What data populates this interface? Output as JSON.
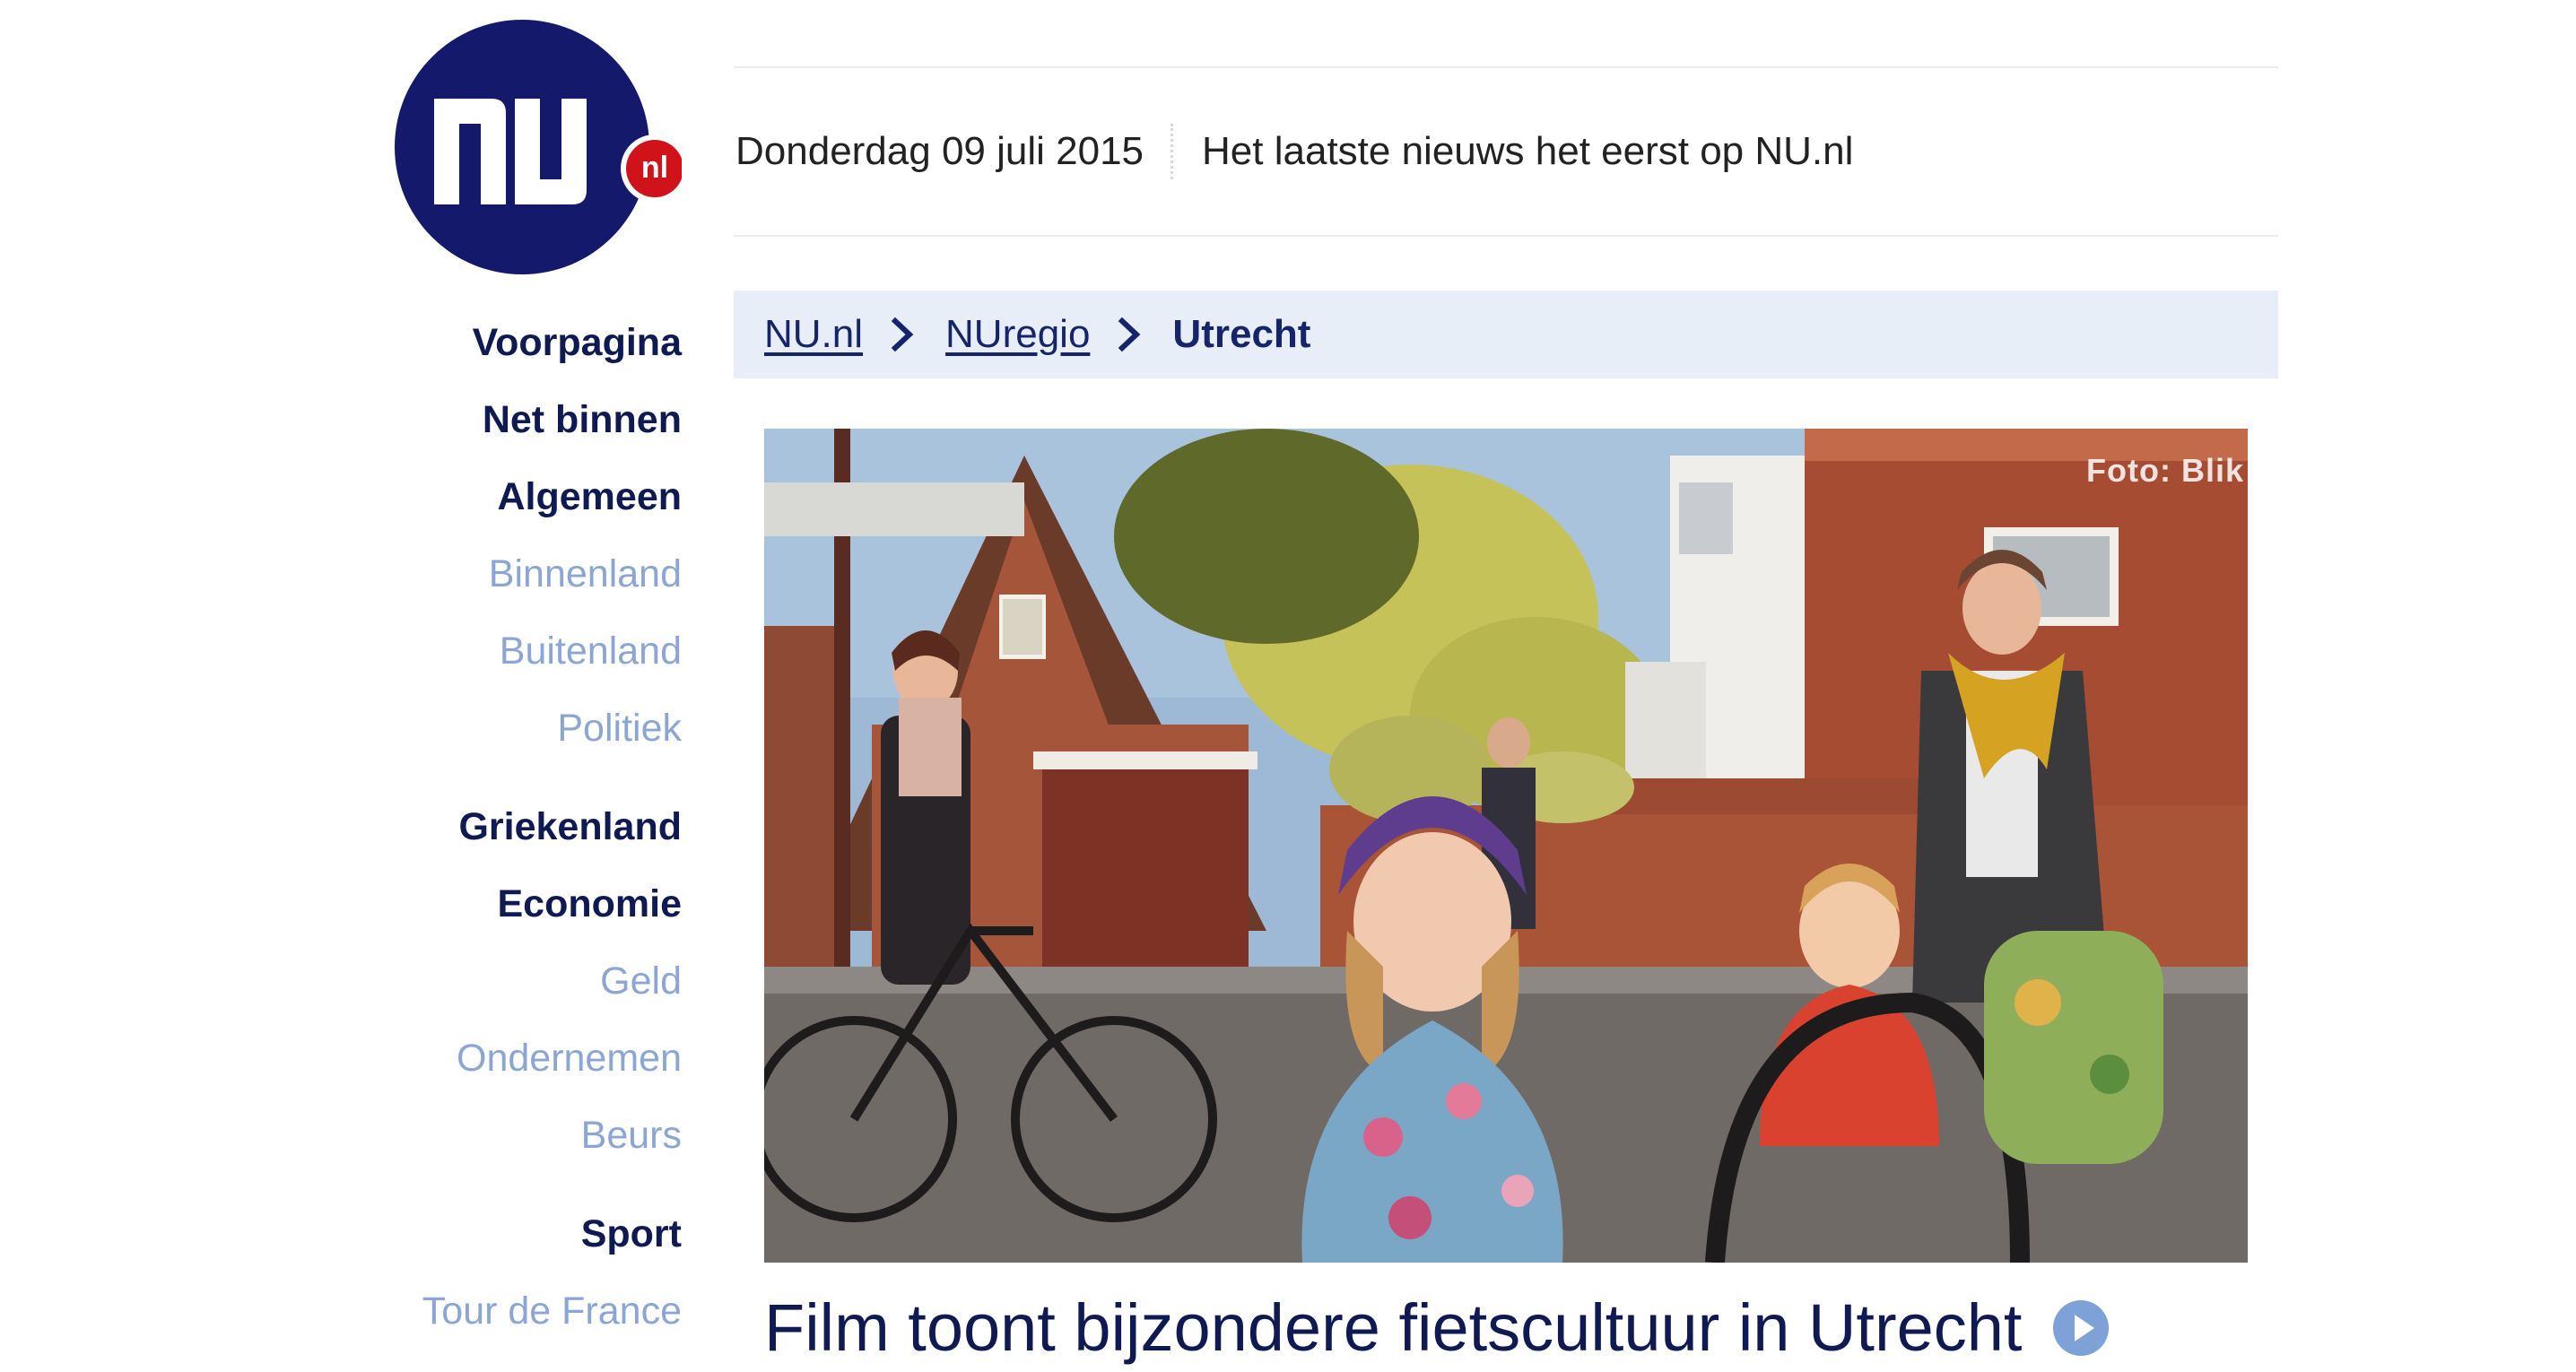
{
  "logo": {
    "text": "NU",
    "badge": "nl"
  },
  "header": {
    "date": "Donderdag 09 juli 2015",
    "tagline": "Het laatste nieuws het eerst op NU.nl"
  },
  "breadcrumb": {
    "items": [
      {
        "label": "NU.nl"
      },
      {
        "label": "NUregio"
      }
    ],
    "current": "Utrecht"
  },
  "nav": {
    "items": [
      {
        "label": "Voorpagina",
        "type": "main"
      },
      {
        "label": "Net binnen",
        "type": "main"
      },
      {
        "label": "Algemeen",
        "type": "main"
      },
      {
        "label": "Binnenland",
        "type": "sub"
      },
      {
        "label": "Buitenland",
        "type": "sub"
      },
      {
        "label": "Politiek",
        "type": "sub"
      },
      {
        "label": "Griekenland",
        "type": "main"
      },
      {
        "label": "Economie",
        "type": "main"
      },
      {
        "label": "Geld",
        "type": "sub"
      },
      {
        "label": "Ondernemen",
        "type": "sub"
      },
      {
        "label": "Beurs",
        "type": "sub"
      },
      {
        "label": "Sport",
        "type": "main"
      },
      {
        "label": "Tour de France",
        "type": "sub"
      }
    ]
  },
  "article": {
    "photo_credit": "Foto: Blik",
    "headline": "Film toont bijzondere fietscultuur in Utrecht"
  },
  "colors": {
    "brand_navy": "#14196b",
    "badge_red": "#d0121b",
    "nav_main": "#101a52",
    "nav_sub": "#8ba6d3",
    "breadcrumb_bg": "#e8eef7",
    "play_icon": "#7ea2d8"
  },
  "icons": {
    "breadcrumb_separator": "chevron-right-icon",
    "headline_video": "play-icon"
  }
}
